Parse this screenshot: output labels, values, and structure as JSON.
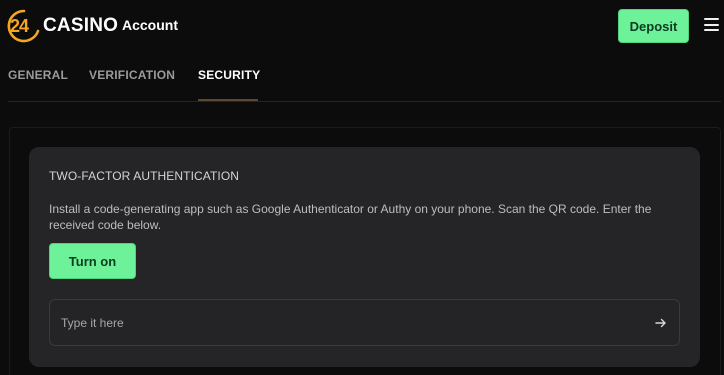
{
  "header": {
    "logo_number": "24",
    "logo_word": "CASINO",
    "page_title": "Account",
    "deposit_label": "Deposit",
    "menu_icon": "hamburger-menu-icon",
    "logo_accent_color": "#f5a623"
  },
  "tabs": [
    {
      "label": "GENERAL",
      "active": false
    },
    {
      "label": "VERIFICATION",
      "active": false
    },
    {
      "label": "SECURITY",
      "active": true
    }
  ],
  "two_factor": {
    "title": "TWO-FACTOR AUTHENTICATION",
    "description": "Install a code-generating app such as Google Authenticator or Authy on your phone. Scan the QR code. Enter the received code below.",
    "turn_on_label": "Turn on",
    "code_value": "",
    "code_placeholder": "Type it here",
    "submit_icon": "arrow-right-icon"
  },
  "colors": {
    "accent_green": "#6df29a",
    "background": "#0c0c0c",
    "card": "#252527"
  }
}
